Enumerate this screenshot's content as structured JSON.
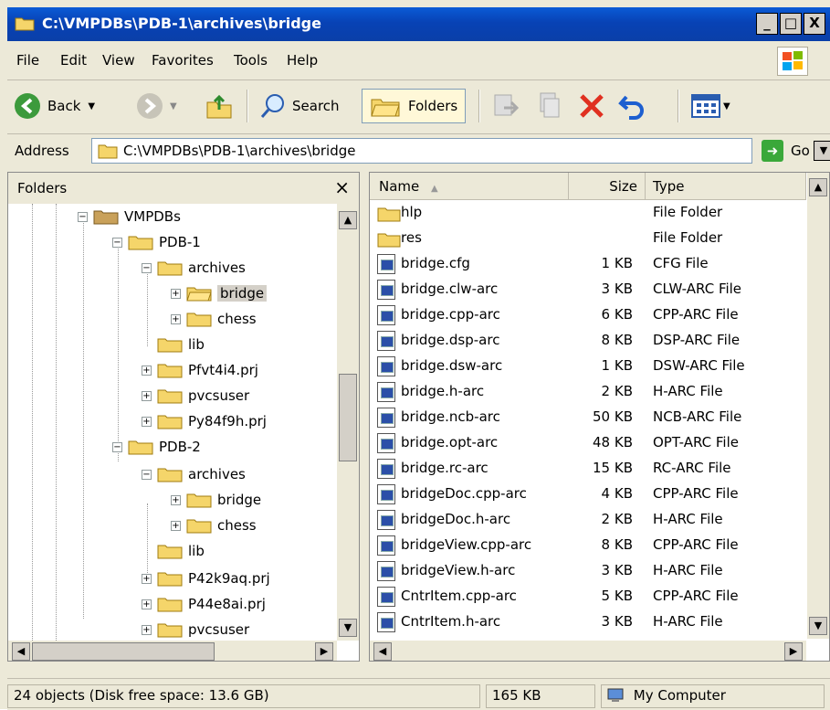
{
  "window": {
    "title": "C:\\VMPDBs\\PDB-1\\archives\\bridge",
    "controls": [
      "_",
      "□",
      "X"
    ]
  },
  "menu": [
    "File",
    "Edit",
    "View",
    "Favorites",
    "Tools",
    "Help"
  ],
  "toolbar": {
    "back_label": "Back",
    "search_label": "Search",
    "folders_label": "Folders"
  },
  "address": {
    "label": "Address",
    "value": "C:\\VMPDBs\\PDB-1\\archives\\bridge",
    "go_label": "Go"
  },
  "folders_pane": {
    "title": "Folders",
    "close": "×",
    "tree": [
      {
        "label": "VMPDBs",
        "expander": "−"
      },
      {
        "label": "PDB-1",
        "expander": "−"
      },
      {
        "label": "archives",
        "expander": "−"
      },
      {
        "label": "bridge",
        "expander": "+",
        "selected": true
      },
      {
        "label": "chess",
        "expander": "+"
      },
      {
        "label": "lib",
        "expander": ""
      },
      {
        "label": "Pfvt4i4.prj",
        "expander": "+"
      },
      {
        "label": "pvcsuser",
        "expander": "+"
      },
      {
        "label": "Py84f9h.prj",
        "expander": "+"
      },
      {
        "label": "PDB-2",
        "expander": "−"
      },
      {
        "label": "archives",
        "expander": "−"
      },
      {
        "label": "bridge",
        "expander": "+"
      },
      {
        "label": "chess",
        "expander": "+"
      },
      {
        "label": "lib",
        "expander": ""
      },
      {
        "label": "P42k9aq.prj",
        "expander": "+"
      },
      {
        "label": "P44e8ai.prj",
        "expander": "+"
      },
      {
        "label": "pvcsuser",
        "expander": "+"
      }
    ]
  },
  "files_pane": {
    "columns": {
      "name": "Name",
      "size": "Size",
      "type": "Type"
    },
    "rows": [
      {
        "name": "hlp",
        "size": "",
        "type": "File Folder",
        "kind": "folder"
      },
      {
        "name": "res",
        "size": "",
        "type": "File Folder",
        "kind": "folder"
      },
      {
        "name": "bridge.cfg",
        "size": "1 KB",
        "type": "CFG File",
        "kind": "file"
      },
      {
        "name": "bridge.clw-arc",
        "size": "3 KB",
        "type": "CLW-ARC File",
        "kind": "file"
      },
      {
        "name": "bridge.cpp-arc",
        "size": "6 KB",
        "type": "CPP-ARC File",
        "kind": "file"
      },
      {
        "name": "bridge.dsp-arc",
        "size": "8 KB",
        "type": "DSP-ARC File",
        "kind": "file"
      },
      {
        "name": "bridge.dsw-arc",
        "size": "1 KB",
        "type": "DSW-ARC File",
        "kind": "file"
      },
      {
        "name": "bridge.h-arc",
        "size": "2 KB",
        "type": "H-ARC File",
        "kind": "file"
      },
      {
        "name": "bridge.ncb-arc",
        "size": "50 KB",
        "type": "NCB-ARC File",
        "kind": "file"
      },
      {
        "name": "bridge.opt-arc",
        "size": "48 KB",
        "type": "OPT-ARC File",
        "kind": "file"
      },
      {
        "name": "bridge.rc-arc",
        "size": "15 KB",
        "type": "RC-ARC File",
        "kind": "file"
      },
      {
        "name": "bridgeDoc.cpp-arc",
        "size": "4 KB",
        "type": "CPP-ARC File",
        "kind": "file"
      },
      {
        "name": "bridgeDoc.h-arc",
        "size": "2 KB",
        "type": "H-ARC File",
        "kind": "file"
      },
      {
        "name": "bridgeView.cpp-arc",
        "size": "8 KB",
        "type": "CPP-ARC File",
        "kind": "file"
      },
      {
        "name": "bridgeView.h-arc",
        "size": "3 KB",
        "type": "H-ARC File",
        "kind": "file"
      },
      {
        "name": "CntrItem.cpp-arc",
        "size": "5 KB",
        "type": "CPP-ARC File",
        "kind": "file"
      },
      {
        "name": "CntrItem.h-arc",
        "size": "3 KB",
        "type": "H-ARC File",
        "kind": "file"
      }
    ]
  },
  "status": {
    "objects": "24 objects (Disk free space: 13.6 GB)",
    "size": "165 KB",
    "zone": "My Computer"
  }
}
